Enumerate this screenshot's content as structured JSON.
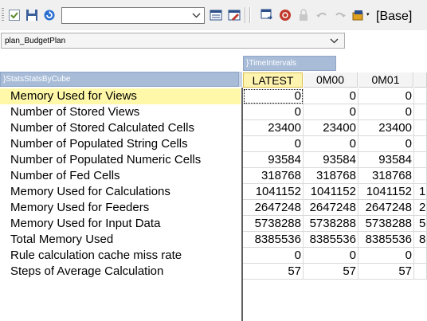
{
  "toolbar": {
    "icons": [
      "checkbox-icon",
      "save-icon",
      "recalculate-icon",
      "view-options-icon",
      "view-design-icon",
      "zero-suppress-icon",
      "stop-icon",
      "lock-icon",
      "undo-icon",
      "redo-icon",
      "sandbox-icon"
    ],
    "view_select_value": "",
    "sandbox_label": "[Base]"
  },
  "view": {
    "selected": "plan_BudgetPlan"
  },
  "cube": {
    "column_dimension": "}TimeIntervals",
    "row_dimension": "}StatsStatsByCube",
    "columns": [
      "LATEST",
      "0M00",
      "0M01"
    ],
    "rows": [
      {
        "label": "Memory Used for Views",
        "values": [
          "0",
          "0",
          "0"
        ],
        "overflow": ""
      },
      {
        "label": "Number of Stored Views",
        "values": [
          "0",
          "0",
          "0"
        ],
        "overflow": ""
      },
      {
        "label": "Number of Stored Calculated Cells",
        "values": [
          "23400",
          "23400",
          "23400"
        ],
        "overflow": ""
      },
      {
        "label": "Number of Populated String Cells",
        "values": [
          "0",
          "0",
          "0"
        ],
        "overflow": ""
      },
      {
        "label": "Number of Populated Numeric Cells",
        "values": [
          "93584",
          "93584",
          "93584"
        ],
        "overflow": ""
      },
      {
        "label": "Number of Fed Cells",
        "values": [
          "318768",
          "318768",
          "318768"
        ],
        "overflow": ""
      },
      {
        "label": "Memory Used for Calculations",
        "values": [
          "1041152",
          "1041152",
          "1041152"
        ],
        "overflow": "1("
      },
      {
        "label": "Memory Used for Feeders",
        "values": [
          "2647248",
          "2647248",
          "2647248"
        ],
        "overflow": "2"
      },
      {
        "label": "Memory Used for Input Data",
        "values": [
          "5738288",
          "5738288",
          "5738288"
        ],
        "overflow": "5"
      },
      {
        "label": "Total Memory Used",
        "values": [
          "8385536",
          "8385536",
          "8385536"
        ],
        "overflow": "8"
      },
      {
        "label": "Rule calculation cache miss rate",
        "values": [
          "0",
          "0",
          "0"
        ],
        "overflow": ""
      },
      {
        "label": "Steps of Average Calculation",
        "values": [
          "57",
          "57",
          "57"
        ],
        "overflow": ""
      }
    ]
  },
  "colors": {
    "dimension_header": "#a8bcd8",
    "active_row": "#fff8a8",
    "active_column": "#fff3b0"
  }
}
